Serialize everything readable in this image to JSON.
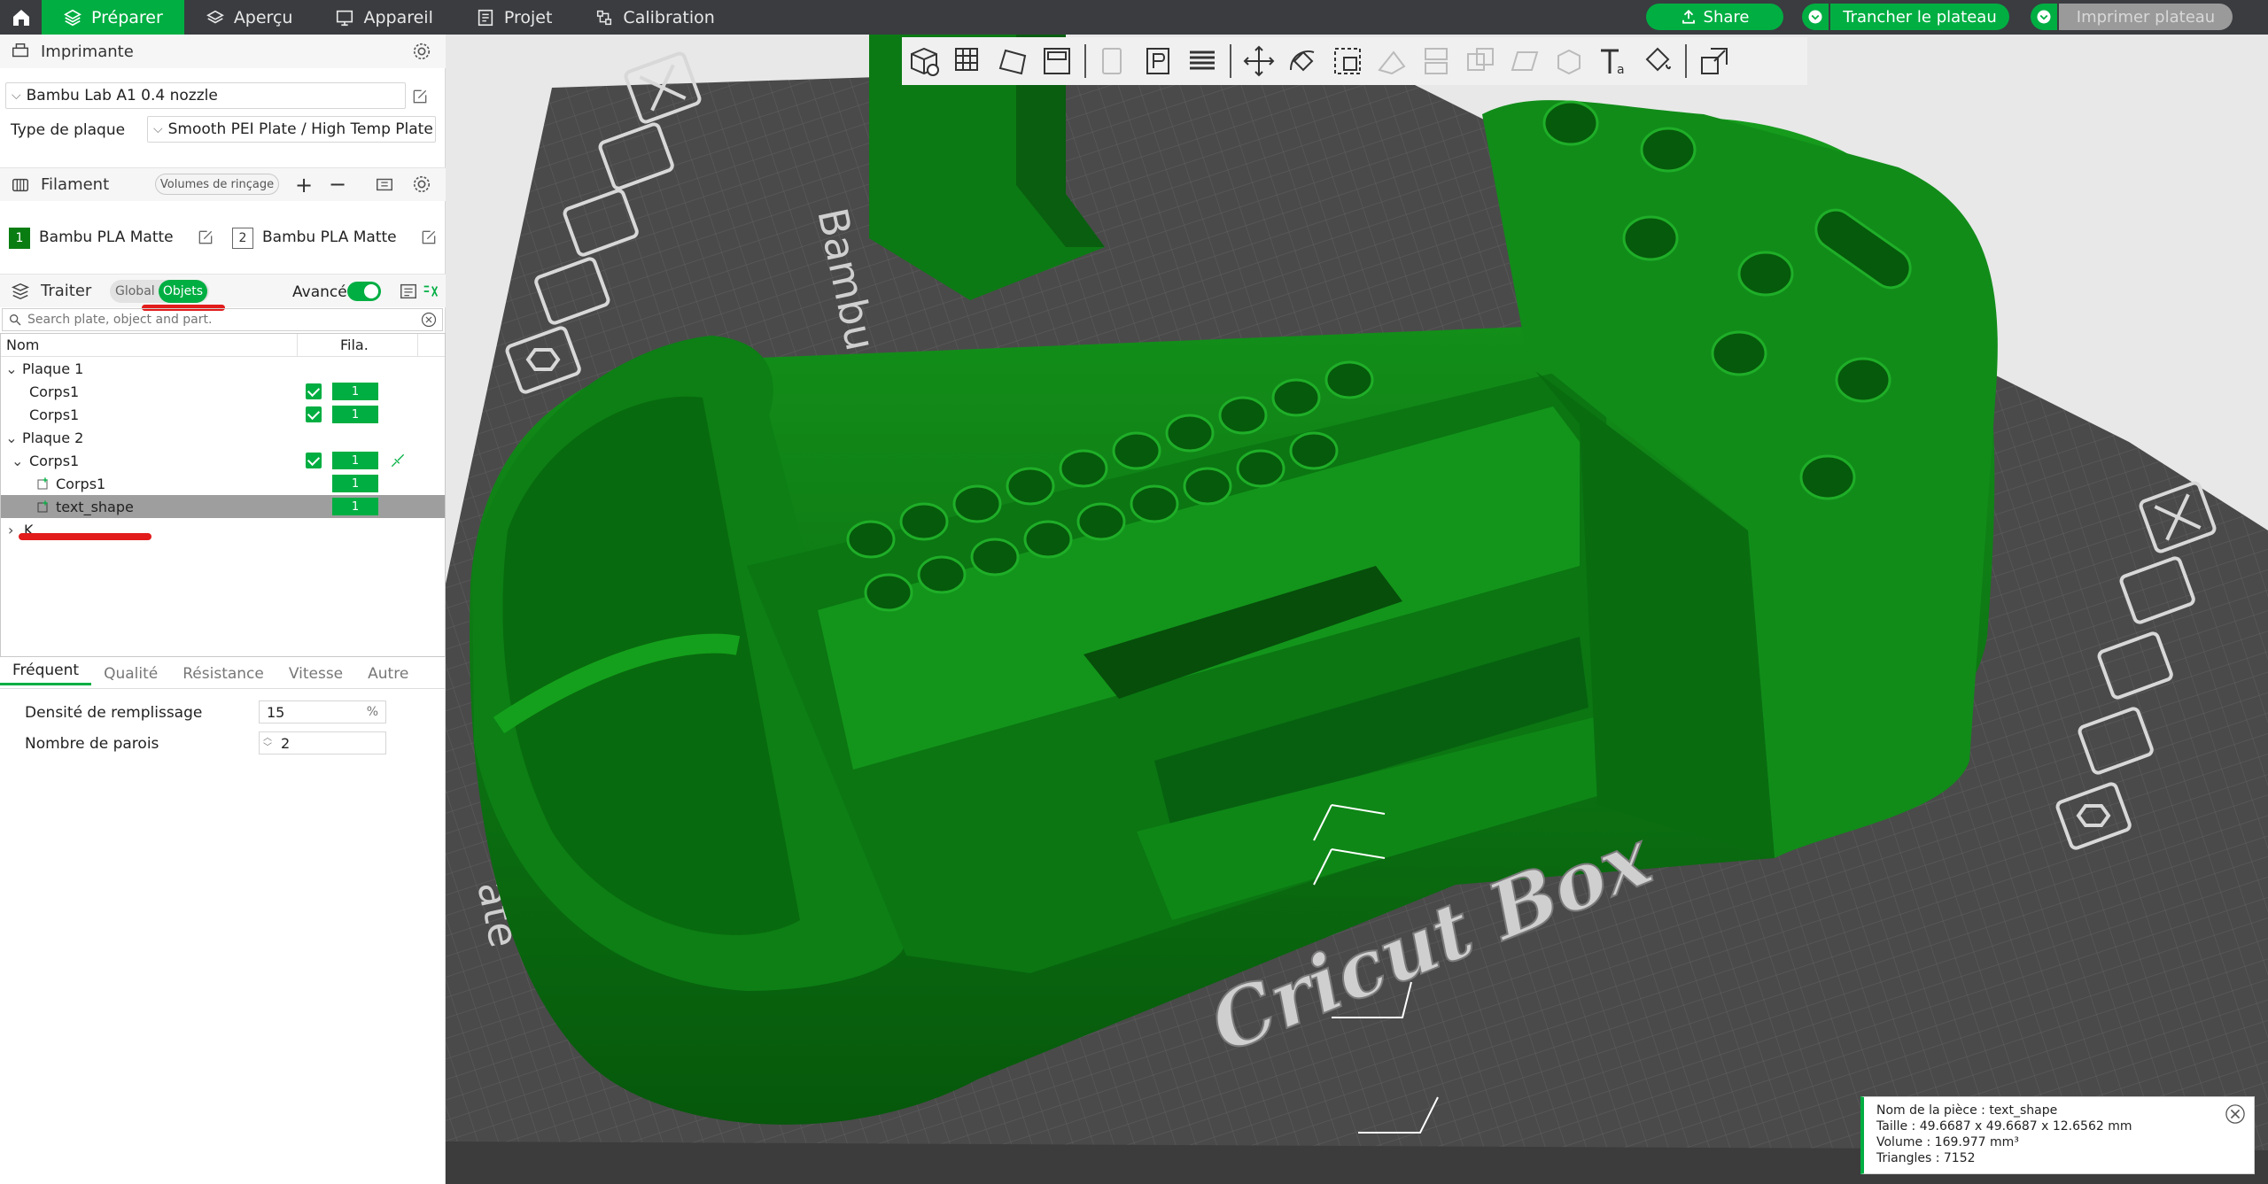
{
  "topbar": {
    "tabs": [
      {
        "label": "Préparer",
        "icon": "prepare-icon",
        "active": true
      },
      {
        "label": "Aperçu",
        "icon": "layers-icon"
      },
      {
        "label": "Appareil",
        "icon": "device-icon"
      },
      {
        "label": "Projet",
        "icon": "project-icon"
      },
      {
        "label": "Calibration",
        "icon": "calibration-icon"
      }
    ],
    "share_label": "Share",
    "slice_label": "Trancher le plateau",
    "print_label": "Imprimer plateau",
    "accent_color": "#00ae42"
  },
  "printer": {
    "section_title": "Imprimante",
    "printer_name": "Bambu Lab A1 0.4 nozzle",
    "plate_type_label": "Type de plaque",
    "plate_type_value": "Smooth PEI Plate / High Temp Plate"
  },
  "filament": {
    "section_title": "Filament",
    "flush_volumes_label": "Volumes de rinçage",
    "slots": [
      {
        "number": "1",
        "name": "Bambu PLA Matte"
      },
      {
        "number": "2",
        "name": "Bambu PLA Matte"
      }
    ]
  },
  "process": {
    "section_title": "Traiter",
    "global_label": "Global",
    "objects_label": "Objets",
    "advanced_label": "Avancé",
    "search_placeholder": "Search plate, object and part."
  },
  "object_list": {
    "col_name": "Nom",
    "col_fila": "Fila.",
    "rows": [
      {
        "name": "Plaque 1",
        "level": 0,
        "expanded": true
      },
      {
        "name": "Corps1",
        "level": 1,
        "checked": true,
        "fila": "1"
      },
      {
        "name": "Corps1",
        "level": 1,
        "checked": true,
        "fila": "1"
      },
      {
        "name": "Plaque 2",
        "level": 0,
        "expanded": true
      },
      {
        "name": "Corps1",
        "level": 1,
        "checked": true,
        "fila": "1",
        "expanded": true
      },
      {
        "name": "Corps1",
        "level": 2,
        "fila": "1"
      },
      {
        "name": "text_shape",
        "level": 2,
        "fila": "1",
        "selected": true
      },
      {
        "name": "K",
        "level": 0
      }
    ]
  },
  "settings_tabs": [
    "Fréquent",
    "Qualité",
    "Résistance",
    "Vitesse",
    "Autre"
  ],
  "settings": {
    "infill_label": "Densité de remplissage",
    "infill_value": "15",
    "infill_unit": "%",
    "walls_label": "Nombre de parois",
    "walls_value": "2"
  },
  "viewport": {
    "model_color": "#0a7d12",
    "plate_text": "Bambu Smooth P",
    "plate_text_2": "ate",
    "embossed_text": "Cricut Box"
  },
  "info_box": {
    "name": "Nom de la pièce : text_shape",
    "size": "Taille : 49.6687 x 49.6687 x 12.6562 mm",
    "volume": "Volume : 169.977 mm³",
    "triangles": "Triangles : 7152"
  }
}
